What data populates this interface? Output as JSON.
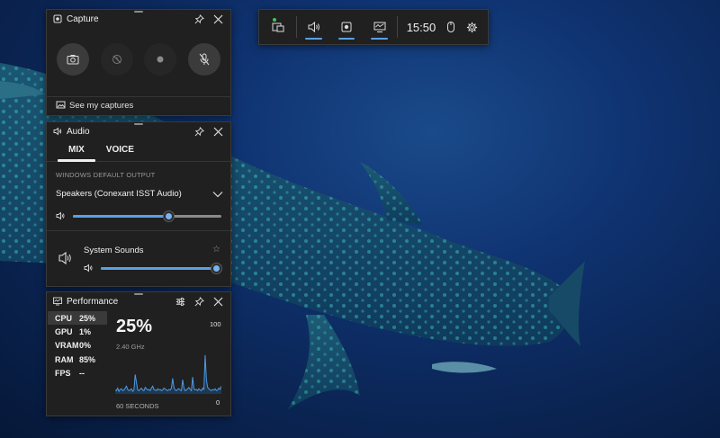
{
  "colors": {
    "accent": "#5aa0e6",
    "panel_bg": "#202020",
    "graph_line": "#4d9ae6",
    "status_dot": "#3fc55a"
  },
  "topbar": {
    "time": "15:50",
    "items": [
      {
        "name": "widget-menu",
        "icon": "widget-menu-icon"
      },
      {
        "name": "audio",
        "icon": "speaker-icon",
        "active": true
      },
      {
        "name": "capture",
        "icon": "capture-icon",
        "active": true
      },
      {
        "name": "performance",
        "icon": "performance-icon",
        "active": true
      },
      {
        "name": "mouse",
        "icon": "mouse-icon"
      },
      {
        "name": "settings",
        "icon": "gear-icon"
      }
    ]
  },
  "capture": {
    "title": "Capture",
    "see_captures": "See my captures",
    "buttons": [
      {
        "name": "screenshot",
        "icon": "camera-icon",
        "enabled": true
      },
      {
        "name": "record-last",
        "icon": "record-last-icon",
        "enabled": false
      },
      {
        "name": "start-recording",
        "icon": "record-dot-icon",
        "enabled": false
      },
      {
        "name": "microphone",
        "icon": "mic-off-icon",
        "enabled": true
      }
    ]
  },
  "audio": {
    "title": "Audio",
    "tabs": [
      "MIX",
      "VOICE"
    ],
    "active_tab": "MIX",
    "section_label": "WINDOWS DEFAULT OUTPUT",
    "device": "Speakers (Conexant ISST Audio)",
    "master_volume": 0.64,
    "apps": [
      {
        "name": "System Sounds",
        "volume": 1.0
      }
    ]
  },
  "performance": {
    "title": "Performance",
    "metrics": [
      {
        "key": "CPU",
        "value": "25%",
        "selected": true
      },
      {
        "key": "GPU",
        "value": "1%"
      },
      {
        "key": "VRAM",
        "value": "0%"
      },
      {
        "key": "RAM",
        "value": "85%"
      },
      {
        "key": "FPS",
        "value": "--"
      }
    ],
    "big_value": "25%",
    "sub": "2.40 GHz",
    "max_label": "100",
    "min_label": "0",
    "span_label": "60 SECONDS",
    "samples": [
      6,
      5,
      9,
      4,
      7,
      8,
      5,
      6,
      9,
      12,
      7,
      5,
      6,
      8,
      4,
      6,
      30,
      18,
      6,
      5,
      7,
      9,
      6,
      5,
      10,
      8,
      6,
      7,
      5,
      9,
      12,
      7,
      6,
      5,
      8,
      6,
      7,
      5,
      6,
      9,
      8,
      6,
      5,
      7,
      6,
      9,
      24,
      10,
      6,
      5,
      7,
      8,
      6,
      5,
      22,
      9,
      5,
      6,
      8,
      10,
      7,
      5,
      26,
      8,
      6,
      7,
      5,
      8,
      6,
      5,
      9,
      7,
      60,
      22,
      10,
      8,
      6,
      5,
      7,
      6,
      8,
      5,
      6,
      9,
      7,
      12
    ]
  }
}
